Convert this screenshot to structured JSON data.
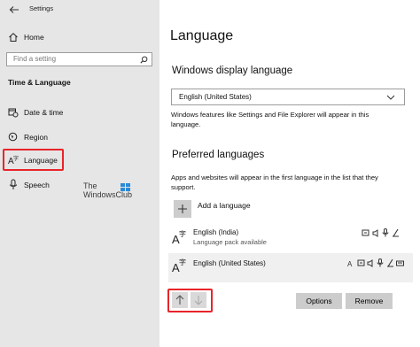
{
  "window": {
    "title": "Settings"
  },
  "sidebar": {
    "home_label": "Home",
    "search_placeholder": "Find a setting",
    "section_title": "Time & Language",
    "items": [
      {
        "label": "Date & time",
        "icon": "calendar-clock-icon"
      },
      {
        "label": "Region",
        "icon": "globe-icon"
      },
      {
        "label": "Language",
        "icon": "language-icon",
        "selected": true
      },
      {
        "label": "Speech",
        "icon": "microphone-icon"
      }
    ]
  },
  "watermark": {
    "line1": "The",
    "line2": "WindowsClub"
  },
  "main": {
    "page_title": "Language",
    "display_language": {
      "heading": "Windows display language",
      "selected_value": "English (United States)",
      "description_line1": "Windows features like Settings and File Explorer will appear in this",
      "description_line2": "language."
    },
    "preferred": {
      "heading": "Preferred languages",
      "description_line1": "Apps and websites will appear in the first language in the list that they",
      "description_line2": "support.",
      "add_label": "Add a language",
      "languages": [
        {
          "name": "English (India)",
          "status": "Language pack available"
        },
        {
          "name": "English (United States)",
          "status": ""
        }
      ],
      "options_label": "Options",
      "remove_label": "Remove"
    }
  }
}
